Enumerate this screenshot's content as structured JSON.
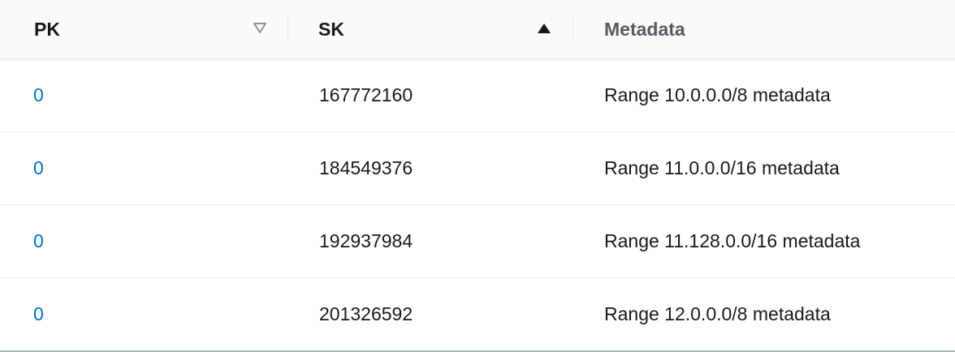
{
  "table": {
    "columns": [
      {
        "key": "pk",
        "label": "PK",
        "sort": "unsorted"
      },
      {
        "key": "sk",
        "label": "SK",
        "sort": "ascending"
      },
      {
        "key": "metadata",
        "label": "Metadata",
        "sort": "none"
      }
    ],
    "rows": [
      {
        "pk": "0",
        "sk": "167772160",
        "metadata": "Range 10.0.0.0/8 metadata"
      },
      {
        "pk": "0",
        "sk": "184549376",
        "metadata": "Range 11.0.0.0/16 metadata"
      },
      {
        "pk": "0",
        "sk": "192937984",
        "metadata": "Range 11.128.0.0/16 metadata"
      },
      {
        "pk": "0",
        "sk": "201326592",
        "metadata": "Range 12.0.0.0/8 metadata"
      }
    ]
  },
  "colors": {
    "link": "#0073bb",
    "text": "#16191f",
    "muted_header": "#545b64",
    "header_bg": "#fafafa",
    "divider": "#e9ebed"
  },
  "icons": {
    "pk_sort": "sort-unsorted-icon",
    "sk_sort": "sort-ascending-icon"
  }
}
